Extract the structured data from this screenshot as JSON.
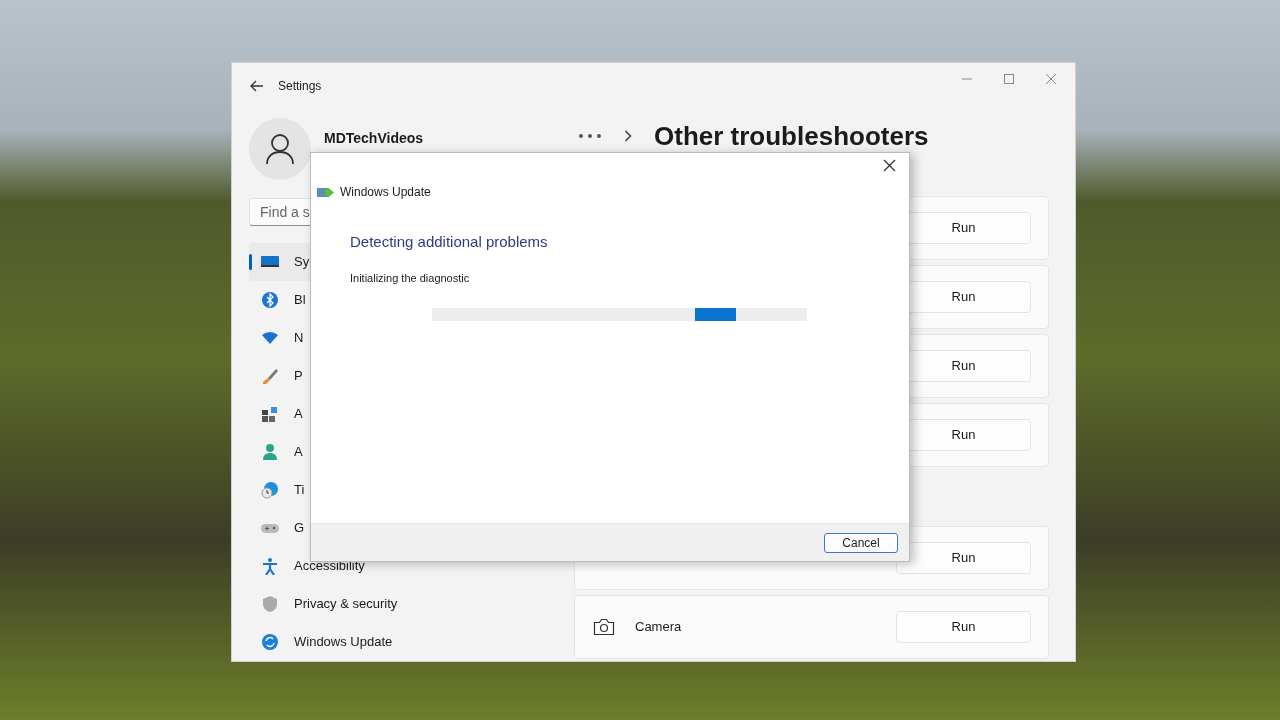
{
  "window": {
    "title": "Settings"
  },
  "account": {
    "name": "MDTechVideos"
  },
  "search": {
    "placeholder": "Find a s"
  },
  "sidebar": {
    "items": [
      {
        "label": "Sy",
        "selected": true
      },
      {
        "label": "Bl",
        "selected": false
      },
      {
        "label": "N",
        "selected": false
      },
      {
        "label": "P",
        "selected": false
      },
      {
        "label": "A",
        "selected": false
      },
      {
        "label": "A",
        "selected": false
      },
      {
        "label": "Ti",
        "selected": false
      },
      {
        "label": "G",
        "selected": false
      },
      {
        "label": "Accessibility",
        "selected": false
      },
      {
        "label": "Privacy & security",
        "selected": false
      },
      {
        "label": "Windows Update",
        "selected": false
      }
    ]
  },
  "page_title": "Other troubleshooters",
  "sections": [
    {
      "items": [
        {
          "button": "Run"
        },
        {
          "button": "Run"
        },
        {
          "button": "Run"
        },
        {
          "button": "Run"
        }
      ]
    },
    {
      "items": [
        {
          "button": "Run"
        },
        {
          "label": "Camera",
          "button": "Run"
        }
      ]
    }
  ],
  "dialog": {
    "app_title": "Windows Update",
    "heading": "Detecting additional problems",
    "status": "Initializing the diagnostic",
    "progress": {
      "level": 0.81
    },
    "buttons": [
      "Cancel"
    ]
  }
}
